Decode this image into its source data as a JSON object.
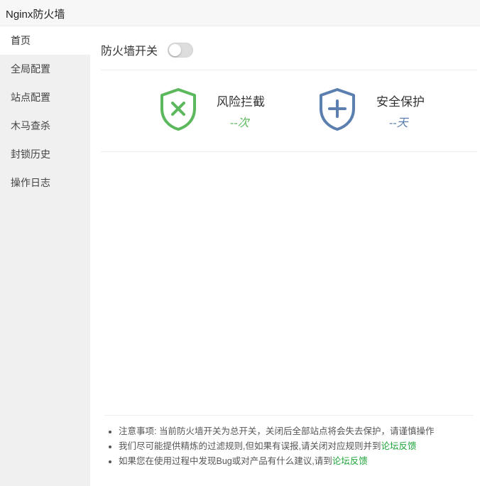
{
  "window": {
    "title": "Nginx防火墙"
  },
  "sidebar": {
    "items": [
      {
        "label": "首页",
        "active": true
      },
      {
        "label": "全局配置"
      },
      {
        "label": "站点配置"
      },
      {
        "label": "木马查杀"
      },
      {
        "label": "封锁历史"
      },
      {
        "label": "操作日志"
      }
    ]
  },
  "main": {
    "switch": {
      "label": "防火墙开关",
      "state": "off"
    },
    "stats": [
      {
        "label": "风险拦截",
        "value": "--",
        "unit": "次",
        "icon": "shield-x-icon",
        "color": "#5cb85c"
      },
      {
        "label": "安全保护",
        "value": "--",
        "unit": "天",
        "icon": "shield-plus-icon",
        "color": "#5b7faf"
      }
    ],
    "notes": [
      {
        "text": "注意事项: 当前防火墙开关为总开关，关闭后全部站点将会失去保护，请谨慎操作"
      },
      {
        "text": "我们尽可能提供精炼的过滤规则,但如果有误报,请关闭对应规则并到",
        "link": "论坛反馈"
      },
      {
        "text": "如果您在使用过程中发现Bug或对产品有什么建议,请到",
        "link": "论坛反馈"
      }
    ]
  }
}
